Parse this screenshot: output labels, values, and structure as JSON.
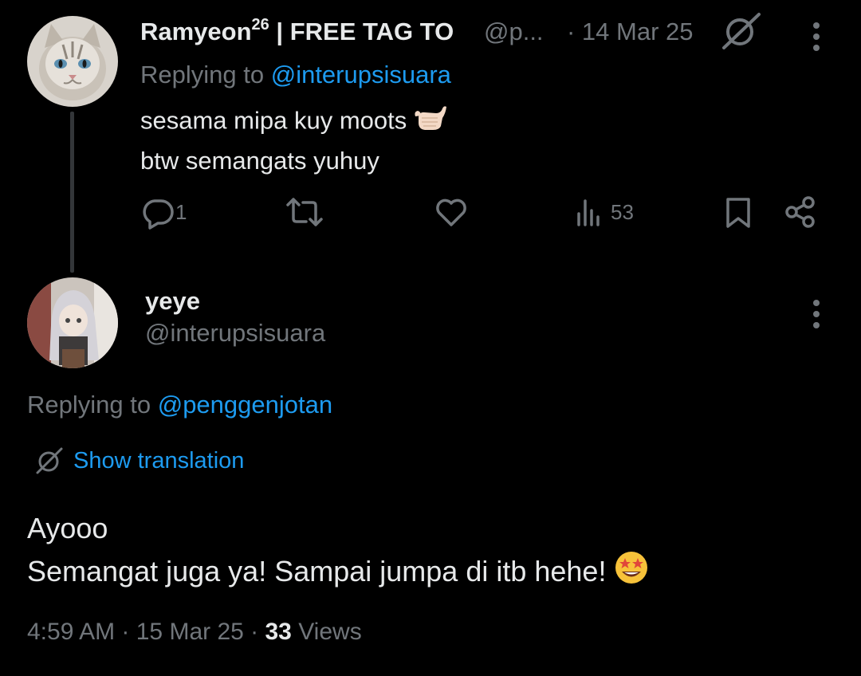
{
  "parent_tweet": {
    "author_name": "Ramyeon",
    "author_sup": "26",
    "author_suffix": " | FREE TAG TO",
    "handle": "@p...",
    "date": "· 14 Mar 25",
    "replying_prefix": "Replying to ",
    "replying_handle": "@interupsisuara",
    "text_line1": "sesama mipa kuy moots",
    "text_line1_emoji": "call-me-hand-emoji",
    "text_line2": "btw semangats yuhuy",
    "actions": {
      "reply_count": "1",
      "retweet_count": "",
      "like_count": "",
      "views_count": "53"
    }
  },
  "reply_tweet": {
    "author_name": "yeye",
    "handle": "@interupsisuara",
    "replying_prefix": "Replying to ",
    "replying_handle": "@penggenjotan",
    "show_translation": "Show translation",
    "text_line1": "Ayooo",
    "text_line2": "Semangat juga ya! Sampai jumpa di itb hehe!",
    "text_line2_emoji": "star-struck-emoji",
    "meta_time": "4:59 AM",
    "meta_sep1": " · ",
    "meta_date": "15 Mar 25",
    "meta_sep2": " · ",
    "meta_views_count": "33",
    "meta_views_label": " Views"
  },
  "colors": {
    "background": "#000000",
    "text": "#e7e9ea",
    "muted": "#71767b",
    "link": "#1d9bf0",
    "thread_line": "#333639"
  }
}
